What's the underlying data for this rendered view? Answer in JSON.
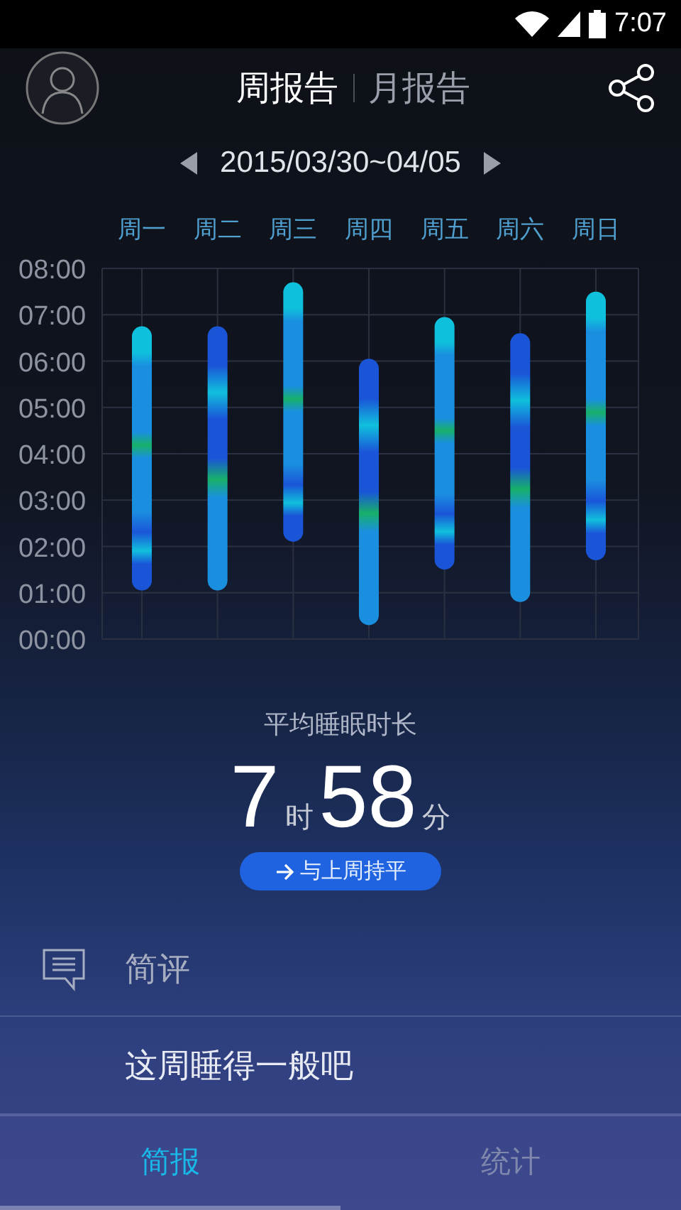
{
  "status_bar": {
    "time": "7:07"
  },
  "header": {
    "tabs": [
      {
        "label": "周报告",
        "selected": true
      },
      {
        "label": "月报告",
        "selected": false
      }
    ]
  },
  "date_range": {
    "label": "2015/03/30~04/05"
  },
  "chart": {
    "days": [
      "周一",
      "周二",
      "周三",
      "周四",
      "周五",
      "周六",
      "周日"
    ],
    "hour_labels": [
      "08:00",
      "07:00",
      "06:00",
      "05:00",
      "04:00",
      "03:00",
      "02:00",
      "01:00",
      "00:00"
    ]
  },
  "summary": {
    "title": "平均睡眠时长",
    "hours": "7",
    "hours_unit": "时",
    "minutes": "58",
    "minutes_unit": "分",
    "comparison": "与上周持平"
  },
  "review": {
    "title": "简评",
    "text": "这周睡得一般吧"
  },
  "bottom_tabs": [
    {
      "label": "简报",
      "selected": true
    },
    {
      "label": "统计",
      "selected": false
    }
  ]
}
